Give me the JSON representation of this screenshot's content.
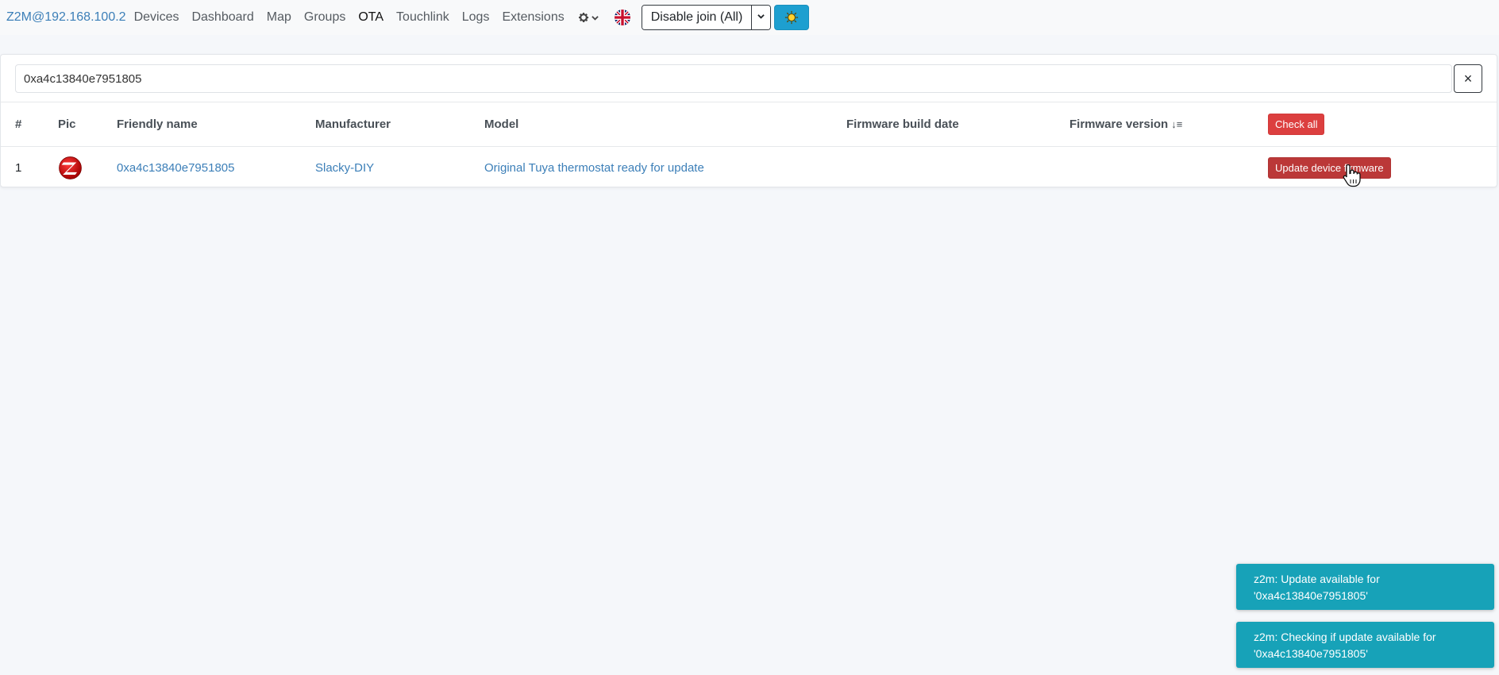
{
  "navbar": {
    "brand": "Z2M@192.168.100.2",
    "links": [
      "Devices",
      "Dashboard",
      "Map",
      "Groups",
      "OTA",
      "Touchlink",
      "Logs",
      "Extensions"
    ],
    "active": "OTA",
    "join_label": "Disable join (All)",
    "join_toggle_icon": "chevron-down-icon",
    "settings_icon": "gear-icon",
    "language_icon": "uk-flag-icon",
    "theme_icon": "sun-icon"
  },
  "search": {
    "value": "0xa4c13840e7951805",
    "clear_label": "×"
  },
  "table": {
    "headers": {
      "num": "#",
      "pic": "Pic",
      "friendly_name": "Friendly name",
      "manufacturer": "Manufacturer",
      "model": "Model",
      "firmware_build_date": "Firmware build date",
      "firmware_version": "Firmware version",
      "sort_icon": "↓≡",
      "check_all": "Check all"
    },
    "rows": [
      {
        "num": "1",
        "pic_icon": "zigbee-logo-icon",
        "friendly_name": "0xa4c13840e7951805",
        "manufacturer": "Slacky-DIY",
        "model": "Original Tuya thermostat ready for update",
        "firmware_build_date": "",
        "firmware_version": "",
        "action": "Update device firmware"
      }
    ]
  },
  "toasts": [
    {
      "line1": "z2m: Update available for",
      "line2": "'0xa4c13840e7951805'"
    },
    {
      "line1": "z2m: Checking if update available for",
      "line2": "'0xa4c13840e7951805'"
    }
  ],
  "colors": {
    "brand": "#3c7fb8",
    "danger": "#dc3f3f",
    "toast": "#17a2b8",
    "theme_button": "#1d9fd0"
  }
}
